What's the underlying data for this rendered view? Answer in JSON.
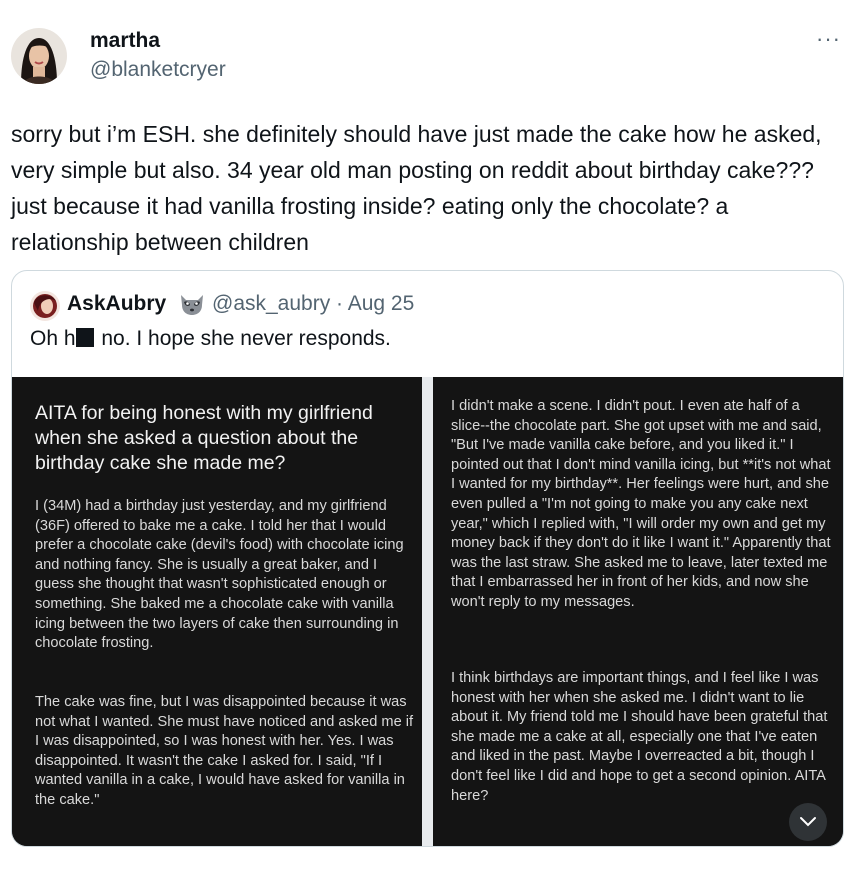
{
  "tweet": {
    "display_name": "martha",
    "handle": "@blanketcryer",
    "more_label": "···",
    "text": "sorry but i’m ESH. she definitely should have just made the cake how he asked, very simple but also. 34 year old man posting on reddit about birthday cake??? just because it had vanilla frosting inside? eating only the chocolate? a relationship between children"
  },
  "quote": {
    "display_name": "AskAubry",
    "emoji": "raccoon-icon",
    "meta": "@ask_aubry · Aug 25",
    "text_before": "Oh h",
    "text_after": " no. I hope she never responds.",
    "left_panel": {
      "title": "AITA for being honest with my girlfriend when she asked a question about the birthday cake she made me?",
      "para1": "I (34M) had a birthday just yesterday, and my girlfriend (36F) offered to bake me a cake. I told her that I would prefer a chocolate cake (devil's food) with chocolate icing and nothing fancy. She is usually a great baker, and I guess she thought that wasn't sophisticated enough or something. She baked me a chocolate cake with vanilla icing between the two layers of cake then surrounding in chocolate frosting.",
      "para2": "The cake was fine, but I was disappointed because it was not what I wanted. She must have noticed and asked me if I was disappointed, so I was honest with her. Yes. I was disappointed. It wasn't the cake I asked for. I said, \"If I wanted vanilla in a cake, I would have asked for vanilla in the cake.\""
    },
    "right_panel": {
      "para1": "I didn't make a scene. I didn't pout. I even ate half of a slice--the chocolate part. She got upset with me and said, \"But I've made vanilla cake before, and you liked it.\" I pointed out that I don't mind vanilla icing, but **it's not what I wanted for my birthday**. Her feelings were hurt, and she even pulled a \"I'm not going to make you any cake next year,\" which I replied with, \"I will order my own and get my money back if they don't do it like I want it.\" Apparently that was the last straw. She asked me to leave, later texted me that I embarrassed her in front of her kids, and now she won't reply to my messages.",
      "para2": "I think birthdays are important things, and I feel like I was honest with her when she asked me. I didn't want to lie about it. My friend told me I should have been grateful that she made me a cake at all, especially one that I've eaten and liked in the past. Maybe I overreacted a bit, though I don't feel like I did and hope to get a second opinion. AITA here?"
    }
  },
  "colors": {
    "text_primary": "#0f1419",
    "text_secondary": "#536471",
    "border": "#cfd9de",
    "media_bg": "#141414"
  },
  "icons": {
    "more": "more-dots-icon",
    "scroll": "chevron-down-icon"
  }
}
